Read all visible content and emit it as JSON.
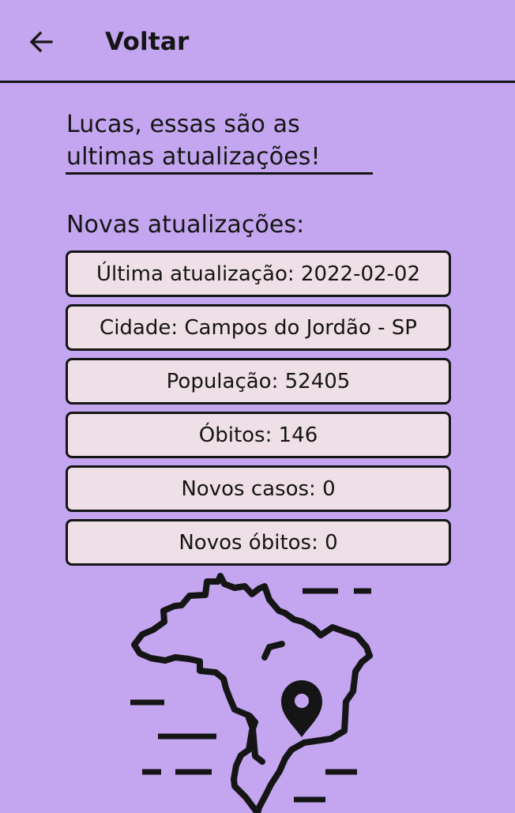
{
  "app_bar": {
    "back_icon": "arrow-left-icon",
    "title": "Voltar"
  },
  "greeting": {
    "text": "Lucas, essas são as ultimas atualizações!"
  },
  "updates": {
    "label": "Novas atualizações:",
    "items": [
      {
        "text": "Última atualização: 2022-02-02"
      },
      {
        "text": "Cidade: Campos do Jordão - SP"
      },
      {
        "text": "População: 52405"
      },
      {
        "text": "Óbitos: 146"
      },
      {
        "text": "Novos casos: 0"
      },
      {
        "text": "Novos óbitos: 0"
      }
    ]
  },
  "illustration": {
    "icon": "brazil-map-location-pin-icon"
  },
  "colors": {
    "background": "#c4a6f0",
    "card_background": "#efdfe6",
    "ink": "#151515"
  }
}
